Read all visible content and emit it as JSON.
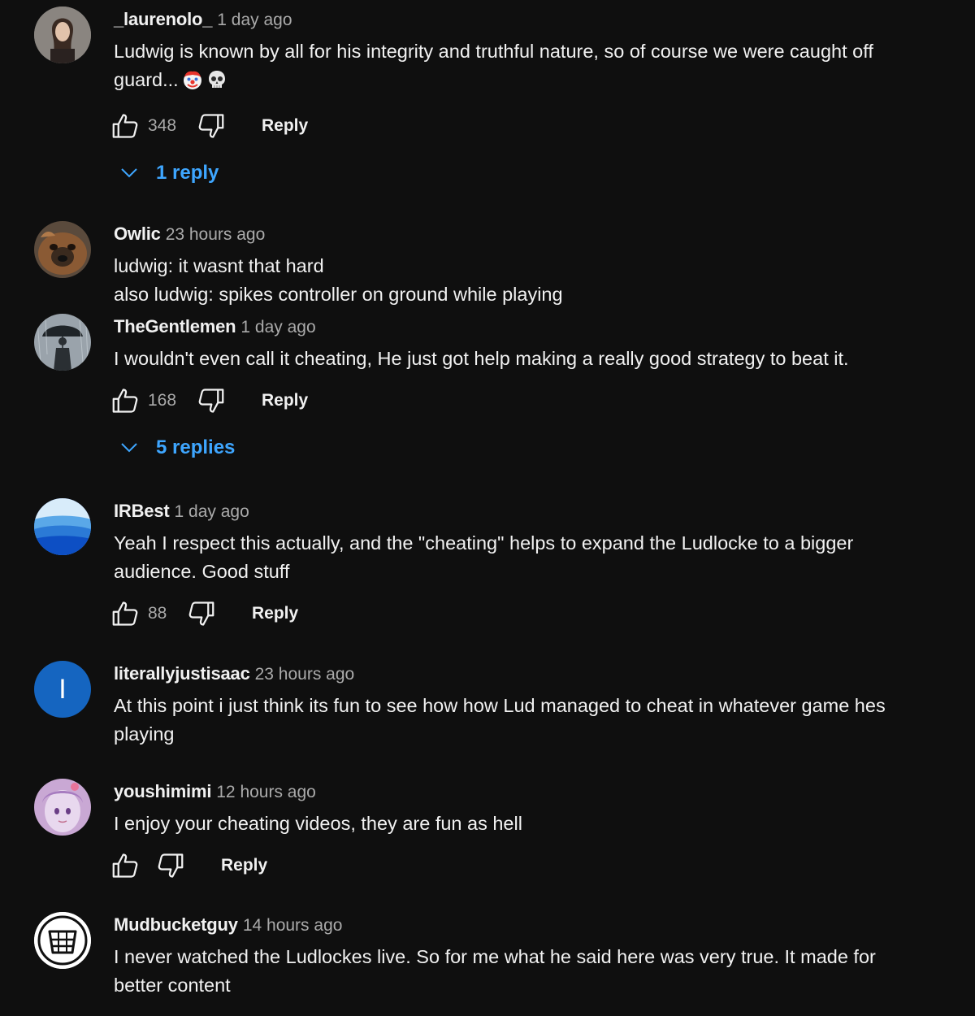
{
  "comments": [
    {
      "author": "_laurenolo_",
      "time": "1 day ago",
      "lines": [
        "Ludwig is known by all for his integrity and truthful nature, so of course we were caught off",
        "guard..."
      ],
      "emojis": [
        "clown-face",
        "skull"
      ],
      "likes": "348",
      "reply_label": "Reply",
      "replies_label": "1 reply"
    },
    {
      "author": "Owlic",
      "time": "23 hours ago",
      "lines": [
        "ludwig: it wasnt that hard",
        "also ludwig: spikes controller on ground while playing"
      ]
    },
    {
      "author": "TheGentlemen",
      "time": "1 day ago",
      "lines": [
        "I wouldn't even call it cheating, He just got help making a really good strategy to beat it."
      ],
      "likes": "168",
      "reply_label": "Reply",
      "replies_label": "5 replies"
    },
    {
      "author": "IRBest",
      "time": "1 day ago",
      "lines": [
        "Yeah I respect this actually, and the \"cheating\" helps to expand the Ludlocke to a bigger",
        "audience. Good stuff"
      ],
      "likes": "88",
      "reply_label": "Reply"
    },
    {
      "author": "literallyjustisaac",
      "time": "23 hours ago",
      "avatar_letter": "I",
      "lines": [
        "At this point i just think its fun to see how how Lud managed to cheat in whatever game hes",
        "playing"
      ]
    },
    {
      "author": "youshimimi",
      "time": "12 hours ago",
      "lines": [
        "I enjoy your cheating videos, they are fun as hell"
      ],
      "reply_label": "Reply"
    },
    {
      "author": "Mudbucketguy",
      "time": "14 hours ago",
      "lines": [
        "I never watched the Ludlockes live. So for me what he said here was very true. It made for",
        "better content"
      ]
    }
  ],
  "colors": {
    "background": "#0f0f0f",
    "text": "#f1f1f1",
    "secondary_text": "#aaaaaa",
    "link_blue": "#3ea6ff",
    "letter_avatar_bg": "#1565c0"
  },
  "icons": [
    "thumb-up-icon",
    "thumb-down-icon",
    "chevron-down-icon",
    "clown-face-emoji",
    "skull-emoji"
  ]
}
